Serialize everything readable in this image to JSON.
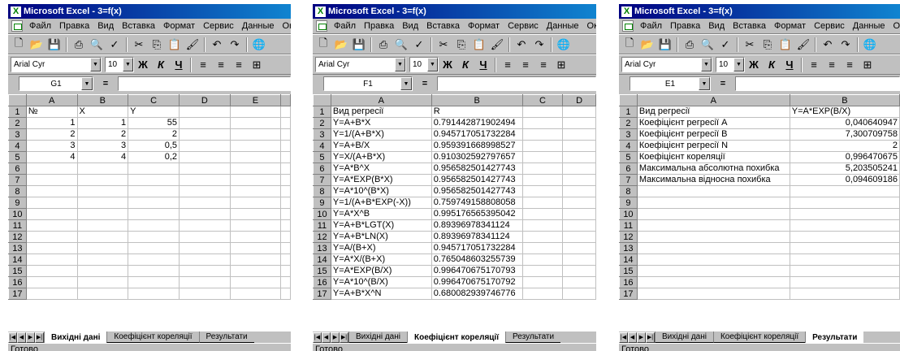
{
  "app_title": "Microsoft Excel - 3=f(x)",
  "menu": [
    "Файл",
    "Правка",
    "Вид",
    "Вставка",
    "Формат",
    "Сервис",
    "Данные",
    "Окно"
  ],
  "font_name": "Arial Cyr",
  "font_size": "10",
  "format_buttons": [
    "Ж",
    "К",
    "Ч"
  ],
  "status": "Готово",
  "tabs": [
    "Вихідні дані",
    "Коефіцієнт кореляції",
    "Результати"
  ],
  "win1": {
    "name_box": "G1",
    "columns": [
      "A",
      "B",
      "C",
      "D",
      "E"
    ],
    "rows": [
      [
        "1",
        "№",
        "X",
        "Y",
        "",
        ""
      ],
      [
        "2",
        "1",
        "1",
        "55",
        "",
        ""
      ],
      [
        "3",
        "2",
        "2",
        "2",
        "",
        ""
      ],
      [
        "4",
        "3",
        "3",
        "0,5",
        "",
        ""
      ],
      [
        "5",
        "4",
        "4",
        "0,2",
        "",
        ""
      ],
      [
        "6",
        "",
        "",
        "",
        "",
        ""
      ],
      [
        "7",
        "",
        "",
        "",
        "",
        ""
      ],
      [
        "8",
        "",
        "",
        "",
        "",
        ""
      ],
      [
        "9",
        "",
        "",
        "",
        "",
        ""
      ],
      [
        "10",
        "",
        "",
        "",
        "",
        ""
      ],
      [
        "11",
        "",
        "",
        "",
        "",
        ""
      ],
      [
        "12",
        "",
        "",
        "",
        "",
        ""
      ],
      [
        "13",
        "",
        "",
        "",
        "",
        ""
      ],
      [
        "14",
        "",
        "",
        "",
        "",
        ""
      ],
      [
        "15",
        "",
        "",
        "",
        "",
        ""
      ],
      [
        "16",
        "",
        "",
        "",
        "",
        ""
      ],
      [
        "17",
        "",
        "",
        "",
        "",
        ""
      ]
    ]
  },
  "win2": {
    "name_box": "F1",
    "columns": [
      "A",
      "B",
      "C",
      "D"
    ],
    "rows": [
      [
        "1",
        "Вид регресії",
        "R",
        "",
        ""
      ],
      [
        "2",
        "Y=A+B*X",
        "0.791442871902494",
        "",
        ""
      ],
      [
        "3",
        "Y=1/(A+B*X)",
        "0.945717051732284",
        "",
        ""
      ],
      [
        "4",
        "Y=A+B/X",
        "0.959391668998527",
        "",
        ""
      ],
      [
        "5",
        "Y=X/(A+B*X)",
        "0.910302592797657",
        "",
        ""
      ],
      [
        "6",
        "Y=A*B^X",
        "0.956582501427743",
        "",
        ""
      ],
      [
        "7",
        "Y=A*EXP(B*X)",
        "0.956582501427743",
        "",
        ""
      ],
      [
        "8",
        "Y=A*10^(B*X)",
        "0.956582501427743",
        "",
        ""
      ],
      [
        "9",
        "Y=1/(A+B*EXP(-X))",
        "0.759749158808058",
        "",
        ""
      ],
      [
        "10",
        "Y=A*X^B",
        "0.995176565395042",
        "",
        ""
      ],
      [
        "11",
        "Y=A+B*LGT(X)",
        "0.89396978341124",
        "",
        ""
      ],
      [
        "12",
        "Y=A+B*LN(X)",
        "0.89396978341124",
        "",
        ""
      ],
      [
        "13",
        "Y=A/(B+X)",
        "0.945717051732284",
        "",
        ""
      ],
      [
        "14",
        "Y=A*X/(B+X)",
        "0.765048603255739",
        "",
        ""
      ],
      [
        "15",
        "Y=A*EXP(B/X)",
        "0.996470675170793",
        "",
        ""
      ],
      [
        "16",
        "Y=A*10^(B/X)",
        "0.996470675170792",
        "",
        ""
      ],
      [
        "17",
        "Y=A+B*X^N",
        "0.680082939746776",
        "",
        ""
      ]
    ]
  },
  "win3": {
    "name_box": "E1",
    "columns": [
      "A",
      "B"
    ],
    "rows": [
      [
        "1",
        "Вид регресії",
        "Y=A*EXP(B/X)"
      ],
      [
        "2",
        "Коефіцієнт регресії A",
        "0,040640947"
      ],
      [
        "3",
        "Коефіцієнт регресії B",
        "7,300709758"
      ],
      [
        "4",
        "Коефіцієнт регресії N",
        "2"
      ],
      [
        "5",
        "Коефіцієнт кореляції",
        "0,996470675"
      ],
      [
        "6",
        "Максимальна абсолютна похибка",
        "5,203505241"
      ],
      [
        "7",
        "Максимальна відносна похибка",
        "0,094609186"
      ],
      [
        "8",
        "",
        ""
      ],
      [
        "9",
        "",
        ""
      ],
      [
        "10",
        "",
        ""
      ],
      [
        "11",
        "",
        ""
      ],
      [
        "12",
        "",
        ""
      ],
      [
        "13",
        "",
        ""
      ],
      [
        "14",
        "",
        ""
      ],
      [
        "15",
        "",
        ""
      ],
      [
        "16",
        "",
        ""
      ],
      [
        "17",
        "",
        ""
      ]
    ]
  }
}
